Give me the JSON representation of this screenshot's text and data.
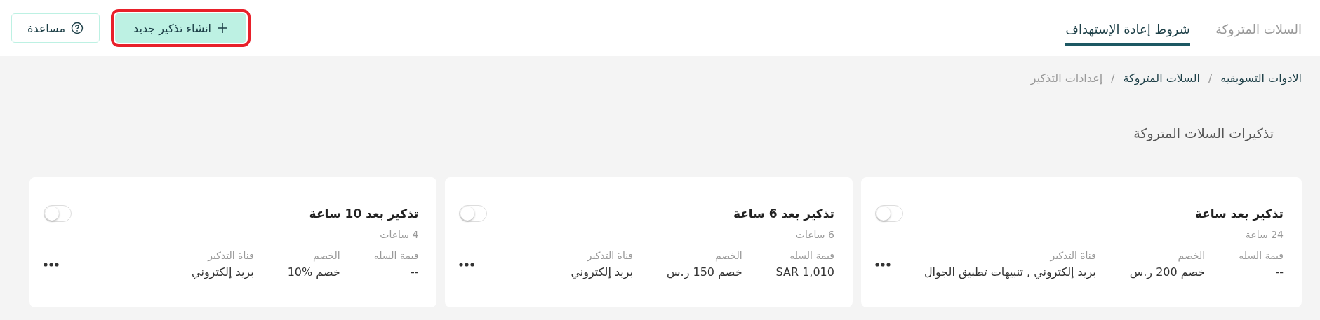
{
  "header": {
    "tabs": [
      {
        "label": "السلات المتروكة",
        "selected": false
      },
      {
        "label": "شروط إعادة الإستهداف",
        "selected": true
      }
    ],
    "actions": [
      {
        "kind": "create",
        "label": "انشاء تذكير جديد",
        "highlighted": true
      },
      {
        "kind": "help",
        "label": "مساعدة",
        "highlighted": false
      }
    ]
  },
  "breadcrumb": [
    {
      "kind": "link",
      "label": "الادوات التسويقيه",
      "current": false
    },
    {
      "kind": "separator",
      "label": "/"
    },
    {
      "kind": "link",
      "label": "السلات المتروكة",
      "current": false
    },
    {
      "kind": "separator",
      "label": "/"
    },
    {
      "kind": "link",
      "label": "إعدادات التذكير",
      "current": true
    }
  ],
  "section_title": "تذكيرات السلات المتروكة",
  "reminders": [
    {
      "title": "تذكير بعد ساعة",
      "subtitle": "24 ساعة",
      "enabled": false,
      "fields": [
        {
          "label": "قيمة السله",
          "value": "--"
        },
        {
          "label": "الخصم",
          "value": "خصم 200 ر.س"
        },
        {
          "label": "قناة التذكير",
          "value": "بريد إلكتروني , تنبيهات تطبيق الجوال"
        }
      ]
    },
    {
      "title": "تذكير بعد 6 ساعة",
      "subtitle": "6 ساعات",
      "enabled": false,
      "fields": [
        {
          "label": "قيمة السله",
          "value": "SAR 1,010"
        },
        {
          "label": "الخصم",
          "value": "خصم 150 ر.س"
        },
        {
          "label": "قناة التذكير",
          "value": "بريد إلكتروني"
        }
      ]
    },
    {
      "title": "تذكير بعد 10 ساعة",
      "subtitle": "4 ساعات",
      "enabled": false,
      "fields": [
        {
          "label": "قيمة السله",
          "value": "--"
        },
        {
          "label": "الخصم",
          "value": "خصم %10"
        },
        {
          "label": "قناة التذكير",
          "value": "بريد إلكتروني"
        }
      ]
    }
  ]
}
